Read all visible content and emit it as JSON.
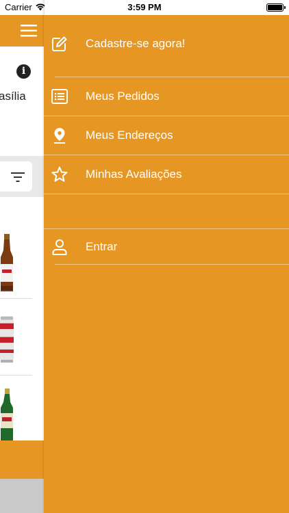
{
  "status_bar": {
    "carrier": "Carrier",
    "time": "3:59 PM"
  },
  "background_screen": {
    "location_text": "asília"
  },
  "drawer": {
    "items": [
      {
        "label": "Cadastre-se agora!",
        "icon": "edit-icon"
      },
      {
        "label": "Meus Pedidos",
        "icon": "list-icon"
      },
      {
        "label": "Meus Endereços",
        "icon": "location-pin-icon"
      },
      {
        "label": "Minhas Avaliações",
        "icon": "star-icon"
      },
      {
        "label": "Entrar",
        "icon": "user-icon"
      }
    ]
  },
  "colors": {
    "accent": "#e69622",
    "drawer_text": "#ffffff"
  }
}
